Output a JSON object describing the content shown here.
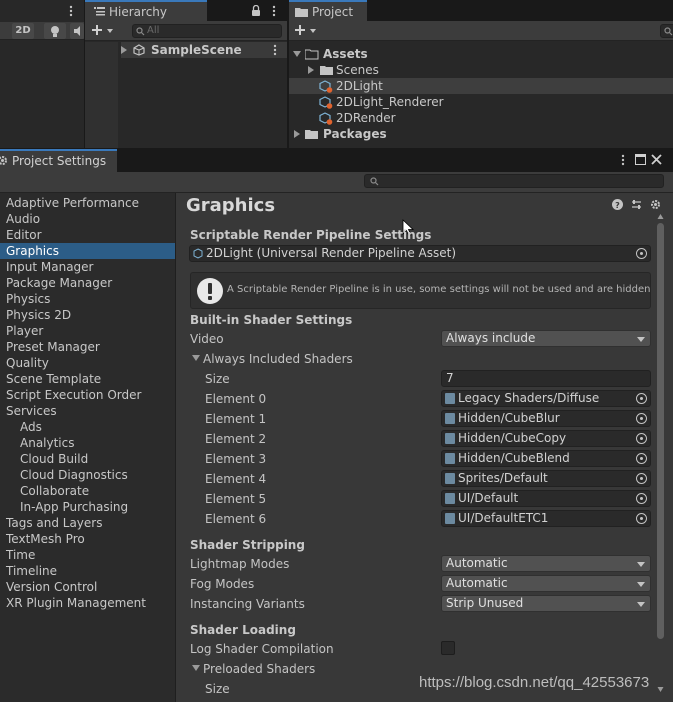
{
  "scene_toolbar": {
    "btn_2d": "2D"
  },
  "hierarchy": {
    "tab_label": "Hierarchy",
    "search_placeholder": "All",
    "root": "SampleScene"
  },
  "project": {
    "tab_label": "Project",
    "tree": {
      "assets": "Assets",
      "scenes": "Scenes",
      "light2d": "2DLight",
      "light2d_renderer": "2DLight_Renderer",
      "render2d": "2DRender",
      "packages": "Packages"
    }
  },
  "project_settings": {
    "tab_label": "Project Settings",
    "sidebar": [
      {
        "label": "Adaptive Performance",
        "indent": 0
      },
      {
        "label": "Audio",
        "indent": 0
      },
      {
        "label": "Editor",
        "indent": 0
      },
      {
        "label": "Graphics",
        "indent": 0,
        "selected": true
      },
      {
        "label": "Input Manager",
        "indent": 0
      },
      {
        "label": "Package Manager",
        "indent": 0
      },
      {
        "label": "Physics",
        "indent": 0
      },
      {
        "label": "Physics 2D",
        "indent": 0
      },
      {
        "label": "Player",
        "indent": 0
      },
      {
        "label": "Preset Manager",
        "indent": 0
      },
      {
        "label": "Quality",
        "indent": 0
      },
      {
        "label": "Scene Template",
        "indent": 0
      },
      {
        "label": "Script Execution Order",
        "indent": 0
      },
      {
        "label": "Services",
        "indent": 0
      },
      {
        "label": "Ads",
        "indent": 1
      },
      {
        "label": "Analytics",
        "indent": 1
      },
      {
        "label": "Cloud Build",
        "indent": 1
      },
      {
        "label": "Cloud Diagnostics",
        "indent": 1
      },
      {
        "label": "Collaborate",
        "indent": 1
      },
      {
        "label": "In-App Purchasing",
        "indent": 1
      },
      {
        "label": "Tags and Layers",
        "indent": 0
      },
      {
        "label": "TextMesh Pro",
        "indent": 0
      },
      {
        "label": "Time",
        "indent": 0
      },
      {
        "label": "Timeline",
        "indent": 0
      },
      {
        "label": "Version Control",
        "indent": 0
      },
      {
        "label": "XR Plugin Management",
        "indent": 0
      }
    ],
    "graphics": {
      "title": "Graphics",
      "srp_header": "Scriptable Render Pipeline Settings",
      "srp_asset": "2DLight (Universal Render Pipeline Asset)",
      "help_text": "A Scriptable Render Pipeline is in use, some settings will not be used and are hidden",
      "builtin_header": "Built-in Shader Settings",
      "video_label": "Video",
      "video_value": "Always include",
      "always_included_label": "Always Included Shaders",
      "size_label": "Size",
      "size_value": "7",
      "elements": [
        {
          "label": "Element 0",
          "value": "Legacy Shaders/Diffuse"
        },
        {
          "label": "Element 1",
          "value": "Hidden/CubeBlur"
        },
        {
          "label": "Element 2",
          "value": "Hidden/CubeCopy"
        },
        {
          "label": "Element 3",
          "value": "Hidden/CubeBlend"
        },
        {
          "label": "Element 4",
          "value": "Sprites/Default"
        },
        {
          "label": "Element 5",
          "value": "UI/Default"
        },
        {
          "label": "Element 6",
          "value": "UI/DefaultETC1"
        }
      ],
      "stripping_header": "Shader Stripping",
      "lightmap_label": "Lightmap Modes",
      "lightmap_value": "Automatic",
      "fog_label": "Fog Modes",
      "fog_value": "Automatic",
      "instancing_label": "Instancing Variants",
      "instancing_value": "Strip Unused",
      "loading_header": "Shader Loading",
      "log_label": "Log Shader Compilation",
      "log_checked": false,
      "preloaded_label": "Preloaded Shaders",
      "preloaded_size_label": "Size"
    }
  },
  "watermark": "https://blog.csdn.net/qq_42553673",
  "colors": {
    "selection": "#2c5d87",
    "accent_tab": "#3a79bb"
  }
}
